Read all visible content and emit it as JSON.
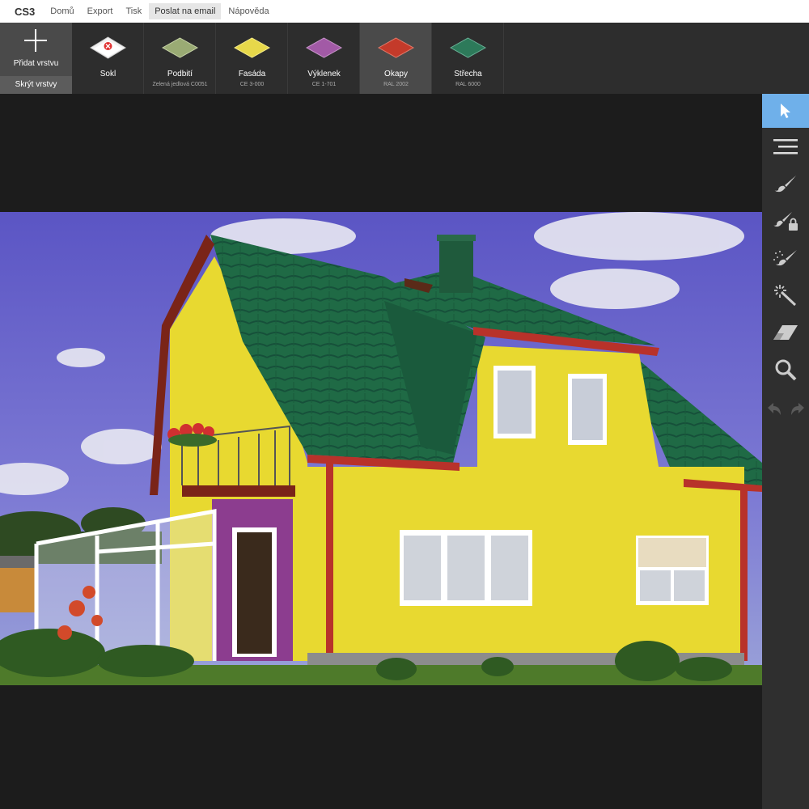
{
  "app": {
    "logo": "CS3"
  },
  "menu": [
    {
      "label": "Domů"
    },
    {
      "label": "Export"
    },
    {
      "label": "Tisk"
    },
    {
      "label": "Poslat na email"
    },
    {
      "label": "Nápověda"
    }
  ],
  "layers": {
    "add_label": "Přidat vrstvu",
    "hide_label": "Skrýt vrstvy",
    "items": [
      {
        "name": "Sokl",
        "sub": "",
        "color": "#ffffff"
      },
      {
        "name": "Podbití",
        "sub": "Zelená jedlová C0051",
        "color": "#9aab74"
      },
      {
        "name": "Fasáda",
        "sub": "CE 3-000",
        "color": "#e7d84a"
      },
      {
        "name": "Výklenek",
        "sub": "CE 1-701",
        "color": "#a25aa6"
      },
      {
        "name": "Okapy",
        "sub": "RAL 2002",
        "color": "#c43a2a"
      },
      {
        "name": "Střecha",
        "sub": "RAL 6000",
        "color": "#2d7a5a"
      }
    ]
  },
  "tools": [
    {
      "icon": "pointer-icon"
    },
    {
      "icon": "menu-lines-icon"
    },
    {
      "icon": "brush-icon"
    },
    {
      "icon": "brush-lock-icon"
    },
    {
      "icon": "spray-brush-icon"
    },
    {
      "icon": "magic-wand-icon"
    },
    {
      "icon": "eraser-icon"
    },
    {
      "icon": "zoom-icon"
    },
    {
      "icon": "undo-icon"
    },
    {
      "icon": "redo-icon"
    }
  ],
  "colors": {
    "accent": "#6fb0ea",
    "roof": "#1f6a45",
    "facade": "#e8d930",
    "niche": "#8c3d8f",
    "gutter": "#b8322a",
    "sky": "#6b63c9"
  }
}
